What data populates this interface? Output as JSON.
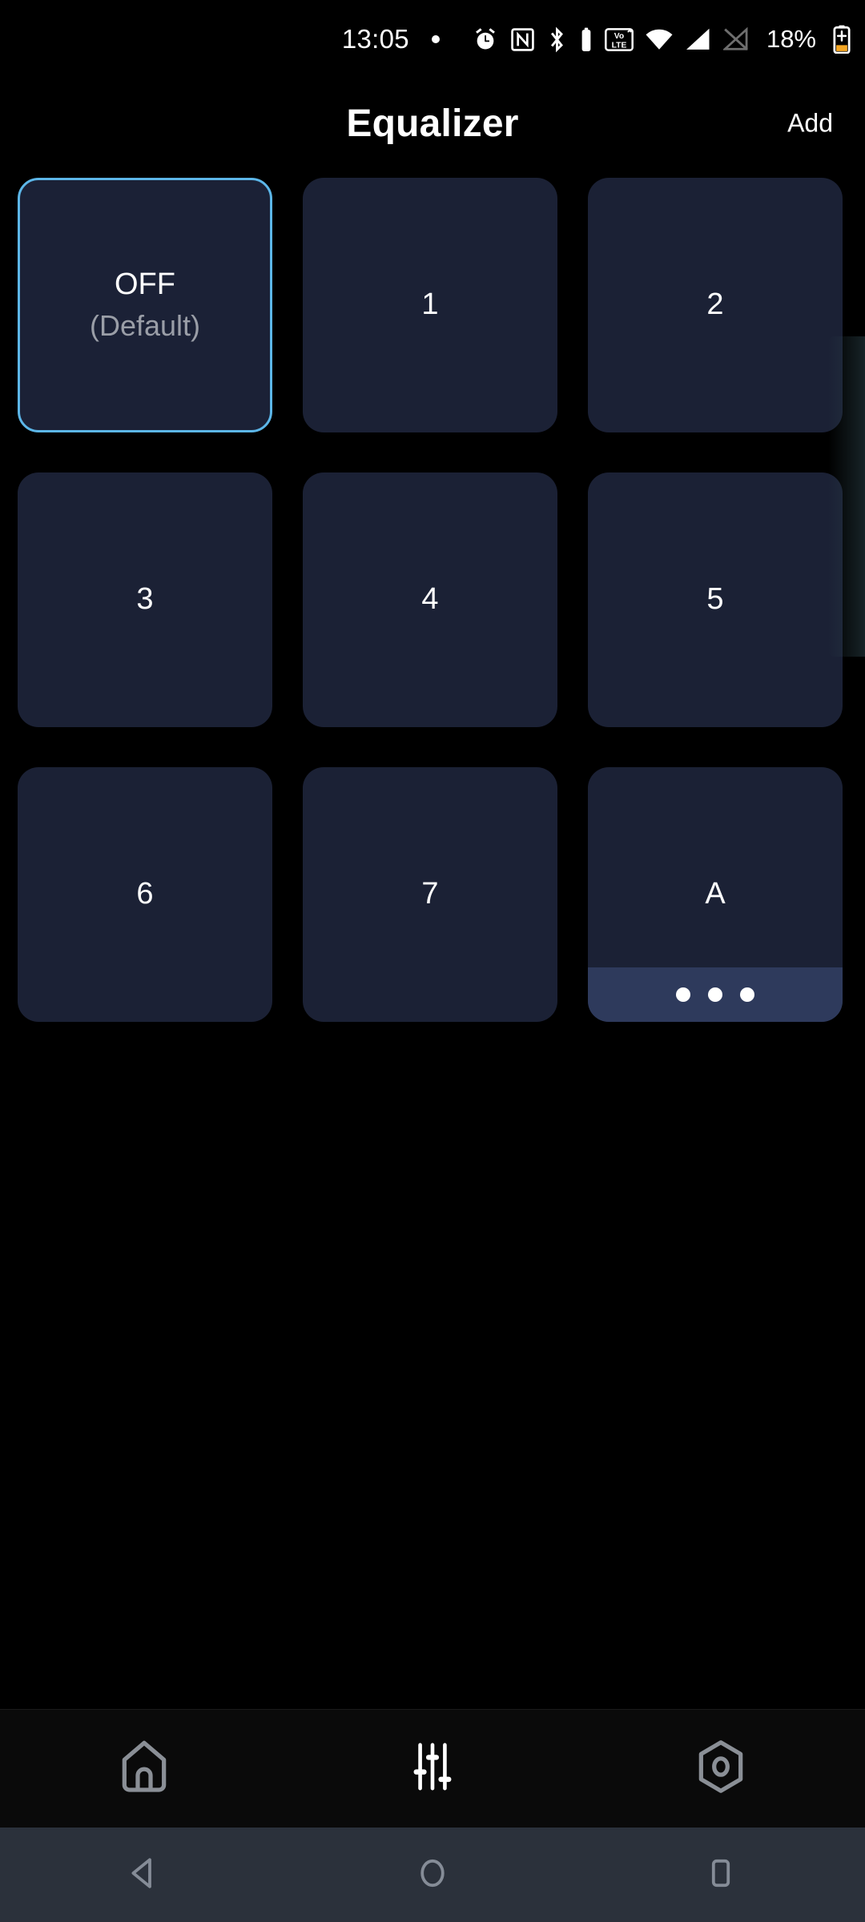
{
  "status_bar": {
    "time": "13:05",
    "battery_percent": "18%",
    "icons": [
      {
        "name": "notification-dot-icon"
      },
      {
        "name": "alarm-clock-icon"
      },
      {
        "name": "nfc-icon"
      },
      {
        "name": "bluetooth-icon"
      },
      {
        "name": "bluetooth-device-battery-icon"
      },
      {
        "name": "volte-icon"
      },
      {
        "name": "wifi-icon"
      },
      {
        "name": "cellular-signal-icon"
      },
      {
        "name": "sim-off-icon"
      },
      {
        "name": "battery-charging-icon"
      }
    ]
  },
  "app_bar": {
    "title": "Equalizer",
    "add_label": "Add"
  },
  "presets": [
    {
      "label": "OFF",
      "sublabel": "(Default)",
      "selected": true,
      "has_footer": false
    },
    {
      "label": "1",
      "sublabel": "",
      "selected": false,
      "has_footer": false
    },
    {
      "label": "2",
      "sublabel": "",
      "selected": false,
      "has_footer": false
    },
    {
      "label": "3",
      "sublabel": "",
      "selected": false,
      "has_footer": false
    },
    {
      "label": "4",
      "sublabel": "",
      "selected": false,
      "has_footer": false
    },
    {
      "label": "5",
      "sublabel": "",
      "selected": false,
      "has_footer": false
    },
    {
      "label": "6",
      "sublabel": "",
      "selected": false,
      "has_footer": false
    },
    {
      "label": "7",
      "sublabel": "",
      "selected": false,
      "has_footer": false
    },
    {
      "label": "A",
      "sublabel": "",
      "selected": false,
      "has_footer": true
    }
  ],
  "bottom_nav": [
    {
      "name": "home-icon",
      "active": false
    },
    {
      "name": "equalizer-icon",
      "active": true
    },
    {
      "name": "settings-hexagon-icon",
      "active": false
    }
  ],
  "system_nav": [
    {
      "name": "back-icon"
    },
    {
      "name": "home-circle-icon"
    },
    {
      "name": "recents-square-icon"
    }
  ],
  "colors": {
    "background": "#000000",
    "tile": "#1b2135",
    "tile_selected_border": "#5cb6e8",
    "tile_footer": "#2e3a5c",
    "text_primary": "#ffffff",
    "text_secondary": "#9a9ea7",
    "system_nav_bg": "#2b313b",
    "nav_inactive": "#8a8f96"
  }
}
